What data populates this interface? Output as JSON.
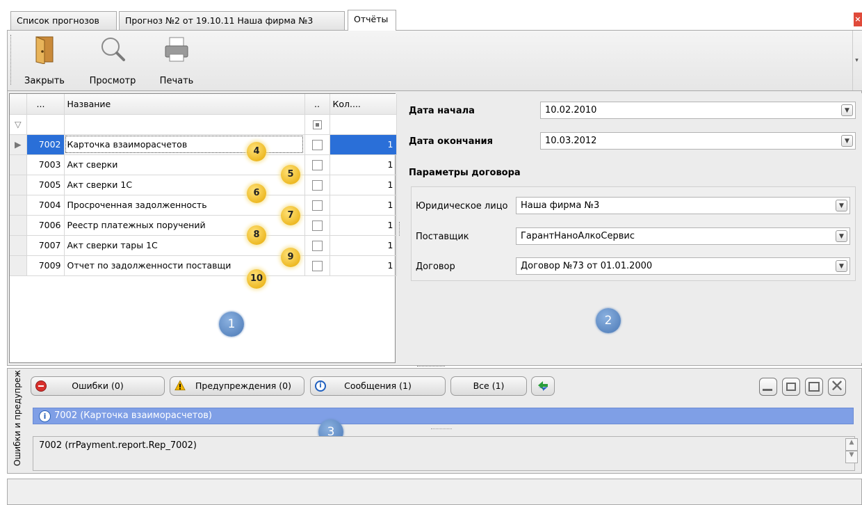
{
  "tabs": [
    {
      "label": "Список прогнозов"
    },
    {
      "label": "Прогноз №2 от 19.10.11 Наша фирма №3"
    },
    {
      "label": "Отчёты"
    }
  ],
  "toolbar": {
    "close_label": "Закрыть",
    "preview_label": "Просмотр",
    "print_label": "Печать"
  },
  "grid": {
    "columns": [
      "...",
      "Название",
      "..",
      "Кол...."
    ],
    "rows": [
      {
        "code": "7002",
        "name": "Карточка взаиморасчетов",
        "qty": "1",
        "marker": "4"
      },
      {
        "code": "7003",
        "name": "Акт сверки",
        "qty": "1",
        "marker": "5"
      },
      {
        "code": "7005",
        "name": "Акт сверки 1С",
        "qty": "1",
        "marker": "6"
      },
      {
        "code": "7004",
        "name": "Просроченная задолженность",
        "qty": "1",
        "marker": "7"
      },
      {
        "code": "7006",
        "name": "Реестр платежных поручений",
        "qty": "1",
        "marker": "8"
      },
      {
        "code": "7007",
        "name": "Акт сверки тары 1С",
        "qty": "1",
        "marker": "9"
      },
      {
        "code": "7009",
        "name": "Отчет по задолженности поставщи",
        "qty": "1",
        "marker": "10"
      }
    ],
    "selected_row": 0,
    "panel_marker": "1"
  },
  "form": {
    "start_label": "Дата начала",
    "start_value": "10.02.2010",
    "end_label": "Дата окончания",
    "end_value": "10.03.2012",
    "group_title": "Параметры договора",
    "legal_label": "Юридическое лицо",
    "legal_value": "Наша фирма №3",
    "supplier_label": "Поставщик",
    "supplier_value": "ГарантНаноАлкоСервис",
    "contract_label": "Договор",
    "contract_value": "Договор №73 от 01.01.2000",
    "panel_marker": "2"
  },
  "messages": {
    "vertical_title": "Ошибки и предупреж",
    "filters": {
      "errors": "Ошибки (0)",
      "warnings": "Предупреждения (0)",
      "info": "Сообщения (1)",
      "all": "Все (1)"
    },
    "selected_message": "7002 (Карточка взаиморасчетов)",
    "detail": "7002 (rrPayment.report.Rep_7002)",
    "panel_marker": "3"
  },
  "colors": {
    "selection": "#2a6fd8",
    "message_row": "#7f9fe6",
    "marker_yellow": "#e6a800",
    "marker_blue": "#4a78b5"
  }
}
